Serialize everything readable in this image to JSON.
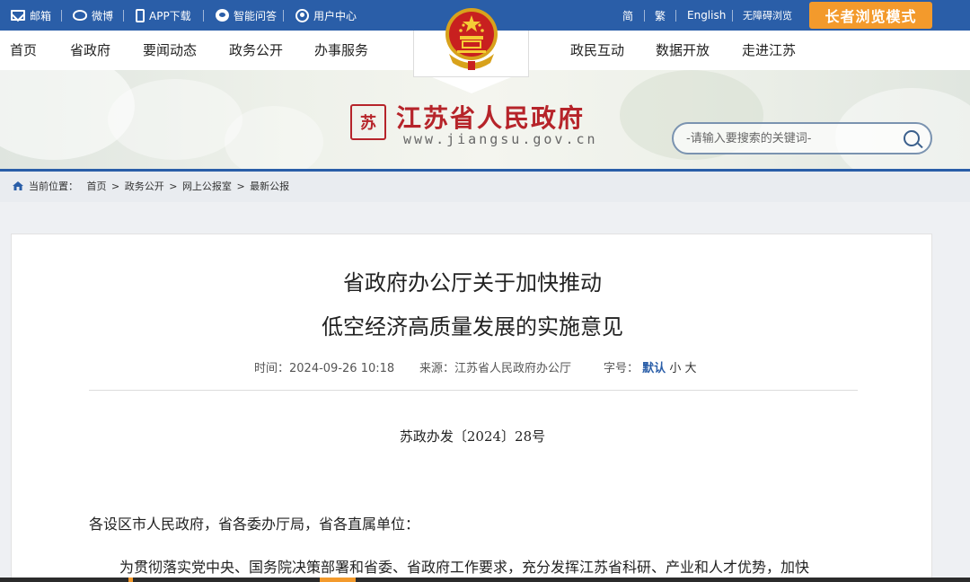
{
  "topbar": {
    "links": [
      {
        "label": "邮箱",
        "icon": "mail-icon"
      },
      {
        "label": "微博",
        "icon": "weibo-icon"
      },
      {
        "label": "APP下载",
        "icon": "phone-icon"
      },
      {
        "label": "智能问答",
        "icon": "chat-icon"
      },
      {
        "label": "用户中心",
        "icon": "user-icon"
      }
    ],
    "lang": [
      "简",
      "繁",
      "English",
      "无障碍浏览"
    ],
    "elder_mode": "长者浏览模式"
  },
  "nav": {
    "left": [
      "首页",
      "省政府",
      "要闻动态",
      "政务公开",
      "办事服务"
    ],
    "right": [
      "政民互动",
      "数据开放",
      "走进江苏"
    ]
  },
  "banner": {
    "seal_text": "苏",
    "site_title": "江苏省人民政府",
    "site_url": "www.jiangsu.gov.cn",
    "search_placeholder": "-请输入要搜索的关键词-"
  },
  "breadcrumb": {
    "prefix": "当前位置：",
    "items": [
      "首页",
      "政务公开",
      "网上公报室",
      "最新公报"
    ],
    "sep": " > "
  },
  "article": {
    "title_line1": "省政府办公厅关于加快推动",
    "title_line2": "低空经济高质量发展的实施意见",
    "time_label": "时间：",
    "time": "2024-09-26 10:18",
    "source_label": "来源：",
    "source": "江苏省人民政府办公厅",
    "font_label": "字号：",
    "font_default": "默认",
    "font_small": "小",
    "font_large": "大",
    "doc_no": "苏政办发〔2024〕28号",
    "para1": "各设区市人民政府，省各委办厅局，省各直属单位：",
    "para2": "为贯彻落实党中央、国务院决策部署和省委、省政府工作要求，充分发挥江苏省科研、产业和人才优势，加快"
  },
  "colors": {
    "primary": "#2a5ea8",
    "accent_orange": "#f39a2c",
    "brand_red": "#b6242a"
  }
}
